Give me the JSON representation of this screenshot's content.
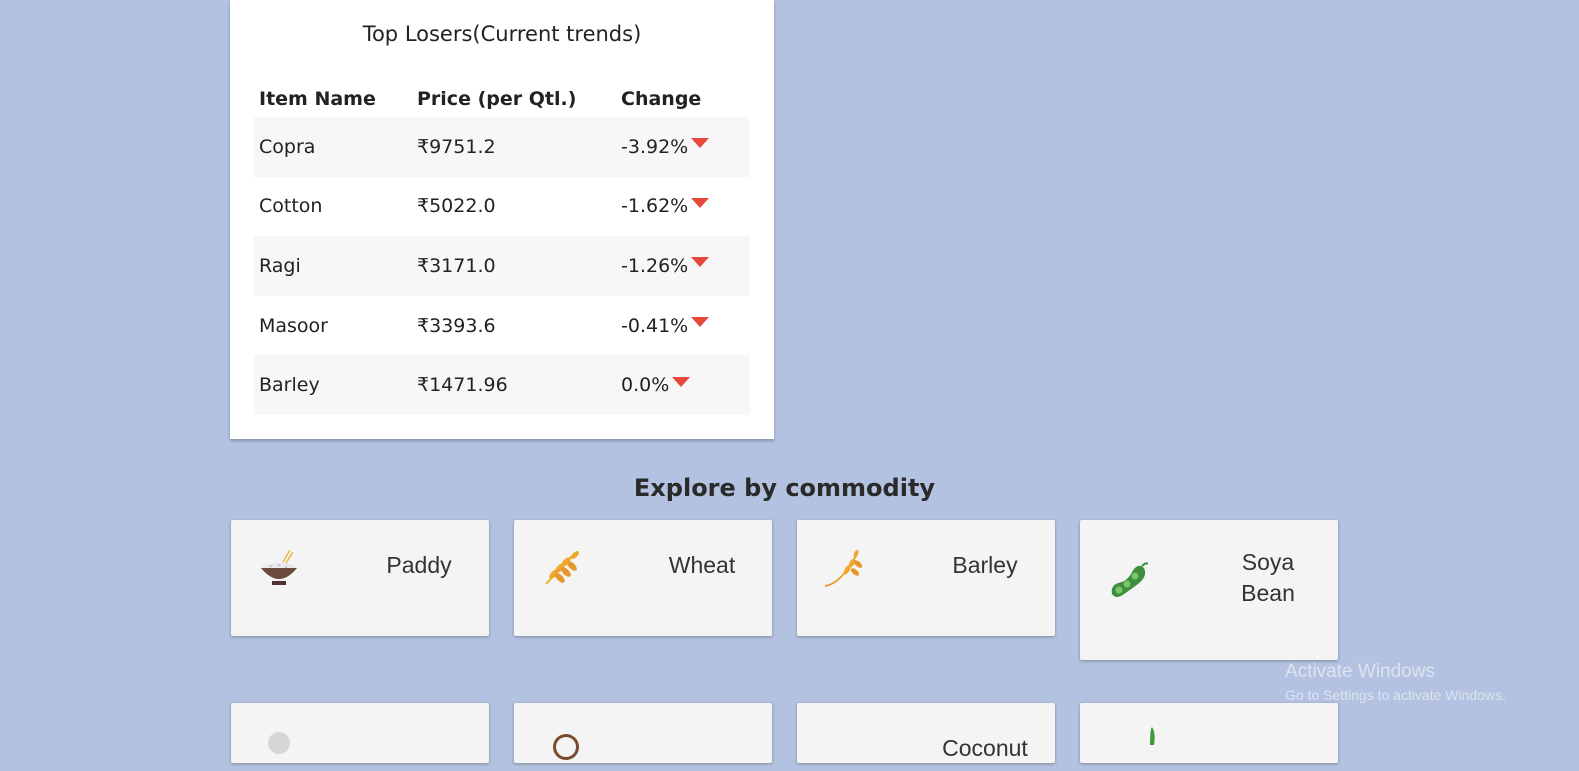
{
  "losers": {
    "title": "Top Losers(Current trends)",
    "headers": {
      "name": "Item Name",
      "price": "Price (per Qtl.)",
      "change": "Change"
    },
    "rows": [
      {
        "name": "Copra",
        "price": "₹9751.2",
        "change": "-3.92%"
      },
      {
        "name": "Cotton",
        "price": "₹5022.0",
        "change": "-1.62%"
      },
      {
        "name": "Ragi",
        "price": "₹3171.0",
        "change": "-1.26%"
      },
      {
        "name": "Masoor",
        "price": "₹3393.6",
        "change": "-0.41%"
      },
      {
        "name": "Barley",
        "price": "₹1471.96",
        "change": "0.0%"
      }
    ],
    "down_color": "#e8473c"
  },
  "explore": {
    "title": "Explore by commodity",
    "tiles": [
      {
        "label": "Paddy",
        "icon": "rice-bowl-icon"
      },
      {
        "label": "Wheat",
        "icon": "wheat-icon"
      },
      {
        "label": "Barley",
        "icon": "barley-icon"
      },
      {
        "label": "Soya\nBean",
        "icon": "soybean-icon"
      }
    ],
    "partial_tile_text": "Coconut"
  },
  "watermark": {
    "line1": "Activate Windows",
    "line2": "Go to Settings to activate Windows."
  },
  "colors": {
    "background": "#b3c2e0",
    "card": "#ffffff",
    "tile": "#f4f4f4"
  }
}
